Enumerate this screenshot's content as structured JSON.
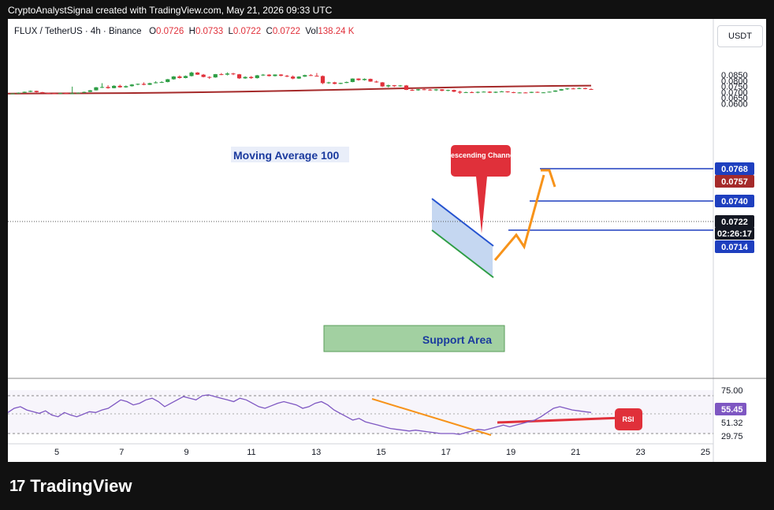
{
  "header": {
    "text": "CryptoAnalystSignal created with TradingView.com, May 21, 2026 09:33 UTC"
  },
  "legend": {
    "pair": "FLUX / TetherUS · 4h · Binance",
    "o_label": "O",
    "o": "0.0726",
    "h_label": "H",
    "h": "0.0733",
    "l_label": "L",
    "l": "0.0722",
    "c_label": "C",
    "c": "0.0722",
    "vol_label": "Vol",
    "vol": "138.24 K"
  },
  "currency_button": "USDT",
  "colors": {
    "up": "#26a69a",
    "up_body": "#2e9e45",
    "down": "#e0303a",
    "ma": "#a52a2a",
    "blue": "#0d2cb8",
    "orange": "#f7931a",
    "rsi": "#7e57c2",
    "support": "#8bc48a"
  },
  "chart_data": {
    "type": "candlestick",
    "price_axis": {
      "ticks": [
        "0.0850",
        "0.0800",
        "0.0750",
        "0.0700",
        "0.0650",
        "0.0600"
      ],
      "ylim": [
        0.0596,
        0.0878
      ]
    },
    "x_axis": {
      "ticks": [
        "5",
        "7",
        "9",
        "11",
        "13",
        "15",
        "17",
        "19",
        "21",
        "23",
        "25"
      ]
    },
    "price_labels": [
      {
        "value": "0.0768",
        "color": "#1e3fbf"
      },
      {
        "value": "0.0757",
        "color": "#a52a2a"
      },
      {
        "value": "0.0740",
        "color": "#1e3fbf"
      },
      {
        "value": "0.0722",
        "color": "#131722"
      },
      {
        "value": "02:26:17",
        "color": "#131722"
      },
      {
        "value": "0.0714",
        "color": "#1e3fbf"
      }
    ],
    "candles": [
      [
        0.0686,
        0.069,
        0.0683,
        0.0689
      ],
      [
        0.0689,
        0.0697,
        0.0687,
        0.0695
      ],
      [
        0.0695,
        0.0705,
        0.0693,
        0.0703
      ],
      [
        0.0703,
        0.0715,
        0.07,
        0.0711
      ],
      [
        0.0711,
        0.0713,
        0.0697,
        0.07
      ],
      [
        0.07,
        0.0702,
        0.069,
        0.0693
      ],
      [
        0.0693,
        0.0696,
        0.0686,
        0.0689
      ],
      [
        0.0689,
        0.0693,
        0.0684,
        0.0686
      ],
      [
        0.0686,
        0.0694,
        0.0684,
        0.0692
      ],
      [
        0.0692,
        0.0696,
        0.0686,
        0.0688
      ],
      [
        0.0688,
        0.0748,
        0.0686,
        0.069
      ],
      [
        0.069,
        0.0697,
        0.0688,
        0.0695
      ],
      [
        0.0695,
        0.0705,
        0.0692,
        0.0702
      ],
      [
        0.0702,
        0.0719,
        0.07,
        0.0716
      ],
      [
        0.0716,
        0.0745,
        0.0714,
        0.0742
      ],
      [
        0.0742,
        0.0778,
        0.0736,
        0.0745
      ],
      [
        0.0745,
        0.076,
        0.073,
        0.0735
      ],
      [
        0.0735,
        0.076,
        0.0733,
        0.0755
      ],
      [
        0.0755,
        0.0765,
        0.0738,
        0.0742
      ],
      [
        0.0742,
        0.0758,
        0.0738,
        0.0752
      ],
      [
        0.0752,
        0.077,
        0.0748,
        0.0766
      ],
      [
        0.0766,
        0.0775,
        0.076,
        0.0772
      ],
      [
        0.0772,
        0.0785,
        0.076,
        0.0764
      ],
      [
        0.0764,
        0.0782,
        0.0762,
        0.0778
      ],
      [
        0.0778,
        0.0795,
        0.0776,
        0.0785
      ],
      [
        0.0785,
        0.0795,
        0.078,
        0.0788
      ],
      [
        0.0788,
        0.0815,
        0.0785,
        0.0812
      ],
      [
        0.0812,
        0.084,
        0.0808,
        0.0836
      ],
      [
        0.0836,
        0.0846,
        0.0818,
        0.0823
      ],
      [
        0.0823,
        0.0845,
        0.082,
        0.084
      ],
      [
        0.084,
        0.0878,
        0.0836,
        0.087
      ],
      [
        0.087,
        0.0874,
        0.085,
        0.0852
      ],
      [
        0.0852,
        0.0858,
        0.0828,
        0.0832
      ],
      [
        0.0832,
        0.0838,
        0.0815,
        0.0828
      ],
      [
        0.0828,
        0.0858,
        0.0825,
        0.0856
      ],
      [
        0.0856,
        0.0866,
        0.0848,
        0.0852
      ],
      [
        0.0852,
        0.0872,
        0.0845,
        0.0862
      ],
      [
        0.0862,
        0.0868,
        0.0848,
        0.0855
      ],
      [
        0.0855,
        0.0858,
        0.0815,
        0.082
      ],
      [
        0.082,
        0.0838,
        0.0815,
        0.0832
      ],
      [
        0.0832,
        0.084,
        0.0815,
        0.0822
      ],
      [
        0.0822,
        0.085,
        0.0818,
        0.0846
      ],
      [
        0.0846,
        0.0858,
        0.084,
        0.0852
      ],
      [
        0.0852,
        0.0856,
        0.0836,
        0.084
      ],
      [
        0.084,
        0.0855,
        0.0836,
        0.0853
      ],
      [
        0.0853,
        0.0856,
        0.0838,
        0.0842
      ],
      [
        0.0842,
        0.085,
        0.083,
        0.0835
      ],
      [
        0.0835,
        0.0845,
        0.0812,
        0.0818
      ],
      [
        0.0818,
        0.0838,
        0.0815,
        0.0835
      ],
      [
        0.0835,
        0.0852,
        0.0832,
        0.0848
      ],
      [
        0.0848,
        0.0856,
        0.084,
        0.0842
      ],
      [
        0.0842,
        0.0866,
        0.0838,
        0.084
      ],
      [
        0.084,
        0.0845,
        0.077,
        0.0778
      ],
      [
        0.0778,
        0.079,
        0.0772,
        0.0785
      ],
      [
        0.0785,
        0.079,
        0.0768,
        0.0772
      ],
      [
        0.0772,
        0.0782,
        0.077,
        0.078
      ],
      [
        0.078,
        0.0792,
        0.0778,
        0.0788
      ],
      [
        0.0788,
        0.082,
        0.0786,
        0.0818
      ],
      [
        0.0818,
        0.082,
        0.08,
        0.0805
      ],
      [
        0.0805,
        0.082,
        0.08,
        0.0815
      ],
      [
        0.0815,
        0.0818,
        0.079,
        0.0792
      ],
      [
        0.0792,
        0.08,
        0.0782,
        0.0785
      ],
      [
        0.0785,
        0.0788,
        0.0745,
        0.075
      ],
      [
        0.075,
        0.0765,
        0.0742,
        0.076
      ],
      [
        0.076,
        0.0762,
        0.0745,
        0.0752
      ],
      [
        0.0752,
        0.0762,
        0.0748,
        0.0758
      ],
      [
        0.0758,
        0.0762,
        0.0718,
        0.072
      ],
      [
        0.072,
        0.0728,
        0.071,
        0.0716
      ],
      [
        0.0716,
        0.0728,
        0.0712,
        0.0725
      ],
      [
        0.0725,
        0.073,
        0.0716,
        0.0722
      ],
      [
        0.0722,
        0.0727,
        0.0712,
        0.0716
      ],
      [
        0.0716,
        0.0728,
        0.071,
        0.0724
      ],
      [
        0.0724,
        0.0726,
        0.0708,
        0.0712
      ],
      [
        0.0712,
        0.0722,
        0.0708,
        0.0719
      ],
      [
        0.0719,
        0.0722,
        0.07,
        0.0704
      ],
      [
        0.0704,
        0.0712,
        0.0686,
        0.0696
      ],
      [
        0.0696,
        0.0704,
        0.0693,
        0.07
      ],
      [
        0.07,
        0.0706,
        0.0692,
        0.0695
      ],
      [
        0.0695,
        0.0706,
        0.069,
        0.0702
      ],
      [
        0.0702,
        0.0708,
        0.0698,
        0.0704
      ],
      [
        0.0704,
        0.0708,
        0.0692,
        0.0695
      ],
      [
        0.0695,
        0.0706,
        0.0692,
        0.0703
      ],
      [
        0.0703,
        0.071,
        0.07,
        0.0706
      ],
      [
        0.0706,
        0.0708,
        0.0696,
        0.07
      ],
      [
        0.07,
        0.0703,
        0.0691,
        0.0693
      ],
      [
        0.0693,
        0.07,
        0.069,
        0.0697
      ],
      [
        0.0697,
        0.07,
        0.0692,
        0.0694
      ],
      [
        0.0694,
        0.0704,
        0.0692,
        0.0702
      ],
      [
        0.0702,
        0.0705,
        0.0694,
        0.0696
      ],
      [
        0.0696,
        0.07,
        0.0692,
        0.0698
      ],
      [
        0.0698,
        0.0706,
        0.0696,
        0.0704
      ],
      [
        0.0704,
        0.0716,
        0.0702,
        0.0714
      ],
      [
        0.0714,
        0.0728,
        0.0712,
        0.0726
      ],
      [
        0.0726,
        0.0736,
        0.072,
        0.0732
      ],
      [
        0.0732,
        0.0738,
        0.0725,
        0.0728
      ],
      [
        0.0728,
        0.074,
        0.0726,
        0.0735
      ],
      [
        0.0735,
        0.0738,
        0.0725,
        0.0727
      ],
      [
        0.0727,
        0.0733,
        0.0722,
        0.0722
      ]
    ],
    "moving_average": {
      "label": "Moving Average 100",
      "values": [
        0.0688,
        0.0689,
        0.069,
        0.0692,
        0.0695,
        0.0699,
        0.0704,
        0.071,
        0.0717,
        0.0724,
        0.0732,
        0.0739,
        0.0745,
        0.075,
        0.0754,
        0.0757
      ]
    },
    "annotations": {
      "channel_label": "Descending Channel",
      "support_label": "Support Area",
      "rsi_label": "RSI"
    },
    "rsi": {
      "ticks": [
        "75.00",
        "55.45",
        "51.32",
        "29.75"
      ],
      "values": [
        55,
        60,
        62,
        58,
        56,
        54,
        57,
        52,
        50,
        55,
        52,
        50,
        53,
        56,
        55,
        58,
        60,
        65,
        70,
        68,
        64,
        66,
        70,
        72,
        68,
        62,
        66,
        70,
        74,
        72,
        70,
        75,
        76,
        74,
        72,
        70,
        68,
        72,
        70,
        66,
        62,
        60,
        63,
        66,
        68,
        66,
        64,
        60,
        62,
        66,
        68,
        64,
        58,
        54,
        50,
        46,
        48,
        44,
        42,
        40,
        38,
        36,
        35,
        34,
        33,
        34,
        33,
        32,
        31,
        30,
        30,
        30,
        29,
        31,
        33,
        35,
        34,
        36,
        38,
        40,
        38,
        40,
        42,
        44,
        46,
        50,
        55,
        60,
        62,
        60,
        58,
        57,
        56,
        55
      ]
    }
  }
}
